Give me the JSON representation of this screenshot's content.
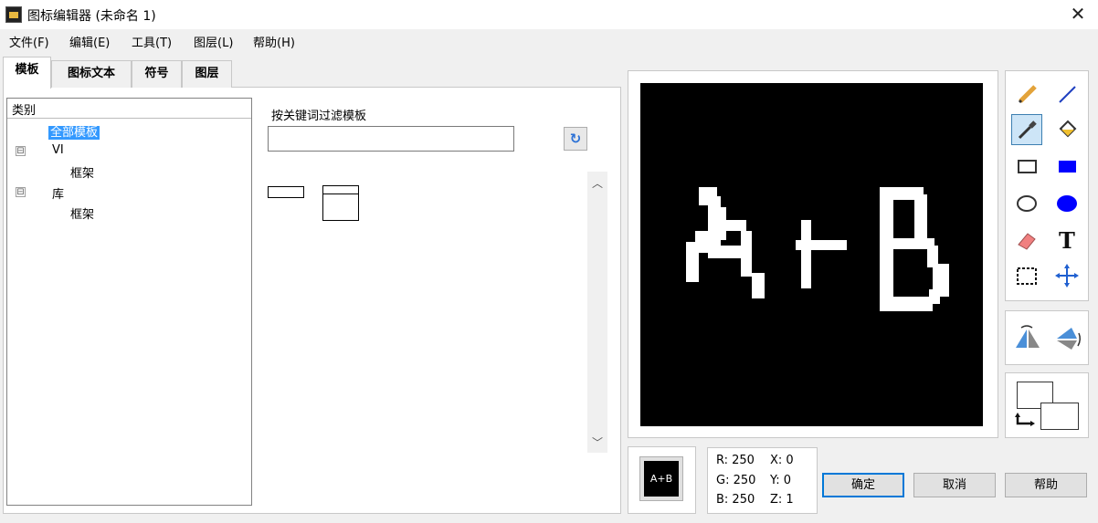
{
  "window": {
    "title": "图标编辑器 (未命名 1)"
  },
  "menu": [
    "文件(F)",
    "编辑(E)",
    "工具(T)",
    "图层(L)",
    "帮助(H)"
  ],
  "tabs": [
    "模板",
    "图标文本",
    "符号",
    "图层"
  ],
  "tree": {
    "header": "类别",
    "items": [
      "全部模板",
      "VI",
      "框架",
      "库",
      "框架"
    ],
    "expanders": [
      "⊟",
      "⊟"
    ]
  },
  "filter": {
    "label": "按关键词过滤模板",
    "value": "",
    "refresh_icon": "↻"
  },
  "icon_text": "A+B",
  "tools": [
    "pencil-icon",
    "line-icon",
    "eyedropper-icon",
    "fill-bucket-icon",
    "rectangle-icon",
    "filled-rectangle-icon",
    "ellipse-icon",
    "filled-ellipse-icon",
    "eraser-icon",
    "text-icon",
    "selection-icon",
    "move-icon"
  ],
  "colors": {
    "accent": "#0078d7",
    "selection": "#3399ff",
    "line_tool": "#2040c0",
    "filled_shape": "#0000ff"
  },
  "info": {
    "r": "R: 250",
    "g": "G: 250",
    "b": "B: 250",
    "x": "X: 0",
    "y": "Y: 0",
    "z": "Z: 1"
  },
  "buttons": {
    "ok": "确定",
    "cancel": "取消",
    "help": "帮助"
  }
}
